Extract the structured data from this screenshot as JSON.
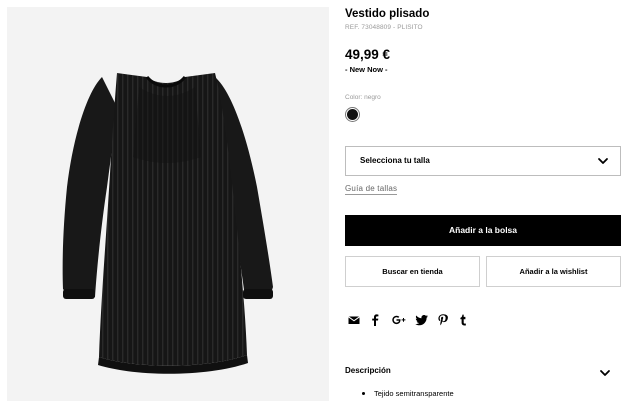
{
  "product": {
    "title": "Vestido plisado",
    "ref": "REF. 73048809 - PLISITO",
    "price": "49,99 €",
    "badge": "- New Now -",
    "color_label": "Color: negro",
    "swatch_color": "#111111"
  },
  "size_select": {
    "label": "Selecciona tu talla",
    "icon": "chevron-down-icon"
  },
  "size_guide": "Guía de tallas",
  "buttons": {
    "add_to_bag": "Añadir a la bolsa",
    "find_in_store": "Buscar en tienda",
    "add_to_wishlist": "Añadir a la wishlist"
  },
  "share_icons": [
    "mail-icon",
    "facebook-icon",
    "google-plus-icon",
    "twitter-icon",
    "pinterest-icon",
    "tumblr-icon"
  ],
  "description": {
    "label": "Descripción",
    "items": [
      "Tejido semitransparente"
    ]
  },
  "colors": {
    "primary_button_bg": "#000000",
    "image_background": "#f3f3f3",
    "muted_text": "#9a9a9a"
  }
}
